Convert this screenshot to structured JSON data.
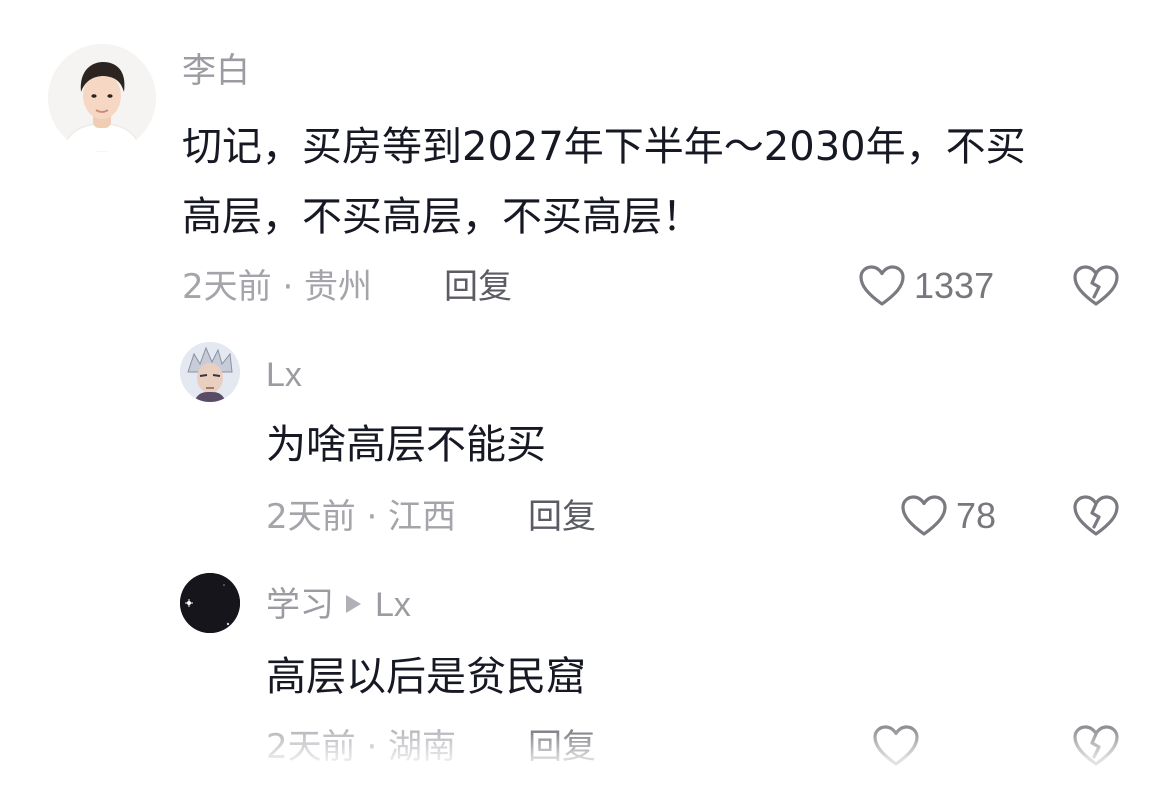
{
  "comments": [
    {
      "author": "李白",
      "text_line1": "切记，买房等到2027年下半年～2030年，不买",
      "text_line2": "高层，不买高层，不买高层！",
      "time_location": "2天前 · 贵州",
      "reply_label": "回复",
      "likes": "1337",
      "avatar_icon": "user-portrait-avatar"
    }
  ],
  "replies": [
    {
      "author": "Lx",
      "text": "为啥高层不能买",
      "time_location": "2天前 · 江西",
      "reply_label": "回复",
      "likes": "78",
      "avatar_icon": "anime-character-avatar"
    },
    {
      "author": "学习",
      "reply_to": "Lx",
      "text": "高层以后是贫民窟",
      "time_location": "2天前 · 湖南",
      "reply_label": "回复",
      "avatar_icon": "dark-night-avatar"
    }
  ],
  "icons": {
    "like": "heart-outline-icon",
    "dislike": "broken-heart-icon",
    "reply_arrow": "play-triangle-icon"
  },
  "colors": {
    "text_primary": "#161823",
    "text_secondary": "#a4a4aa",
    "reply_link": "#5b5b63"
  }
}
